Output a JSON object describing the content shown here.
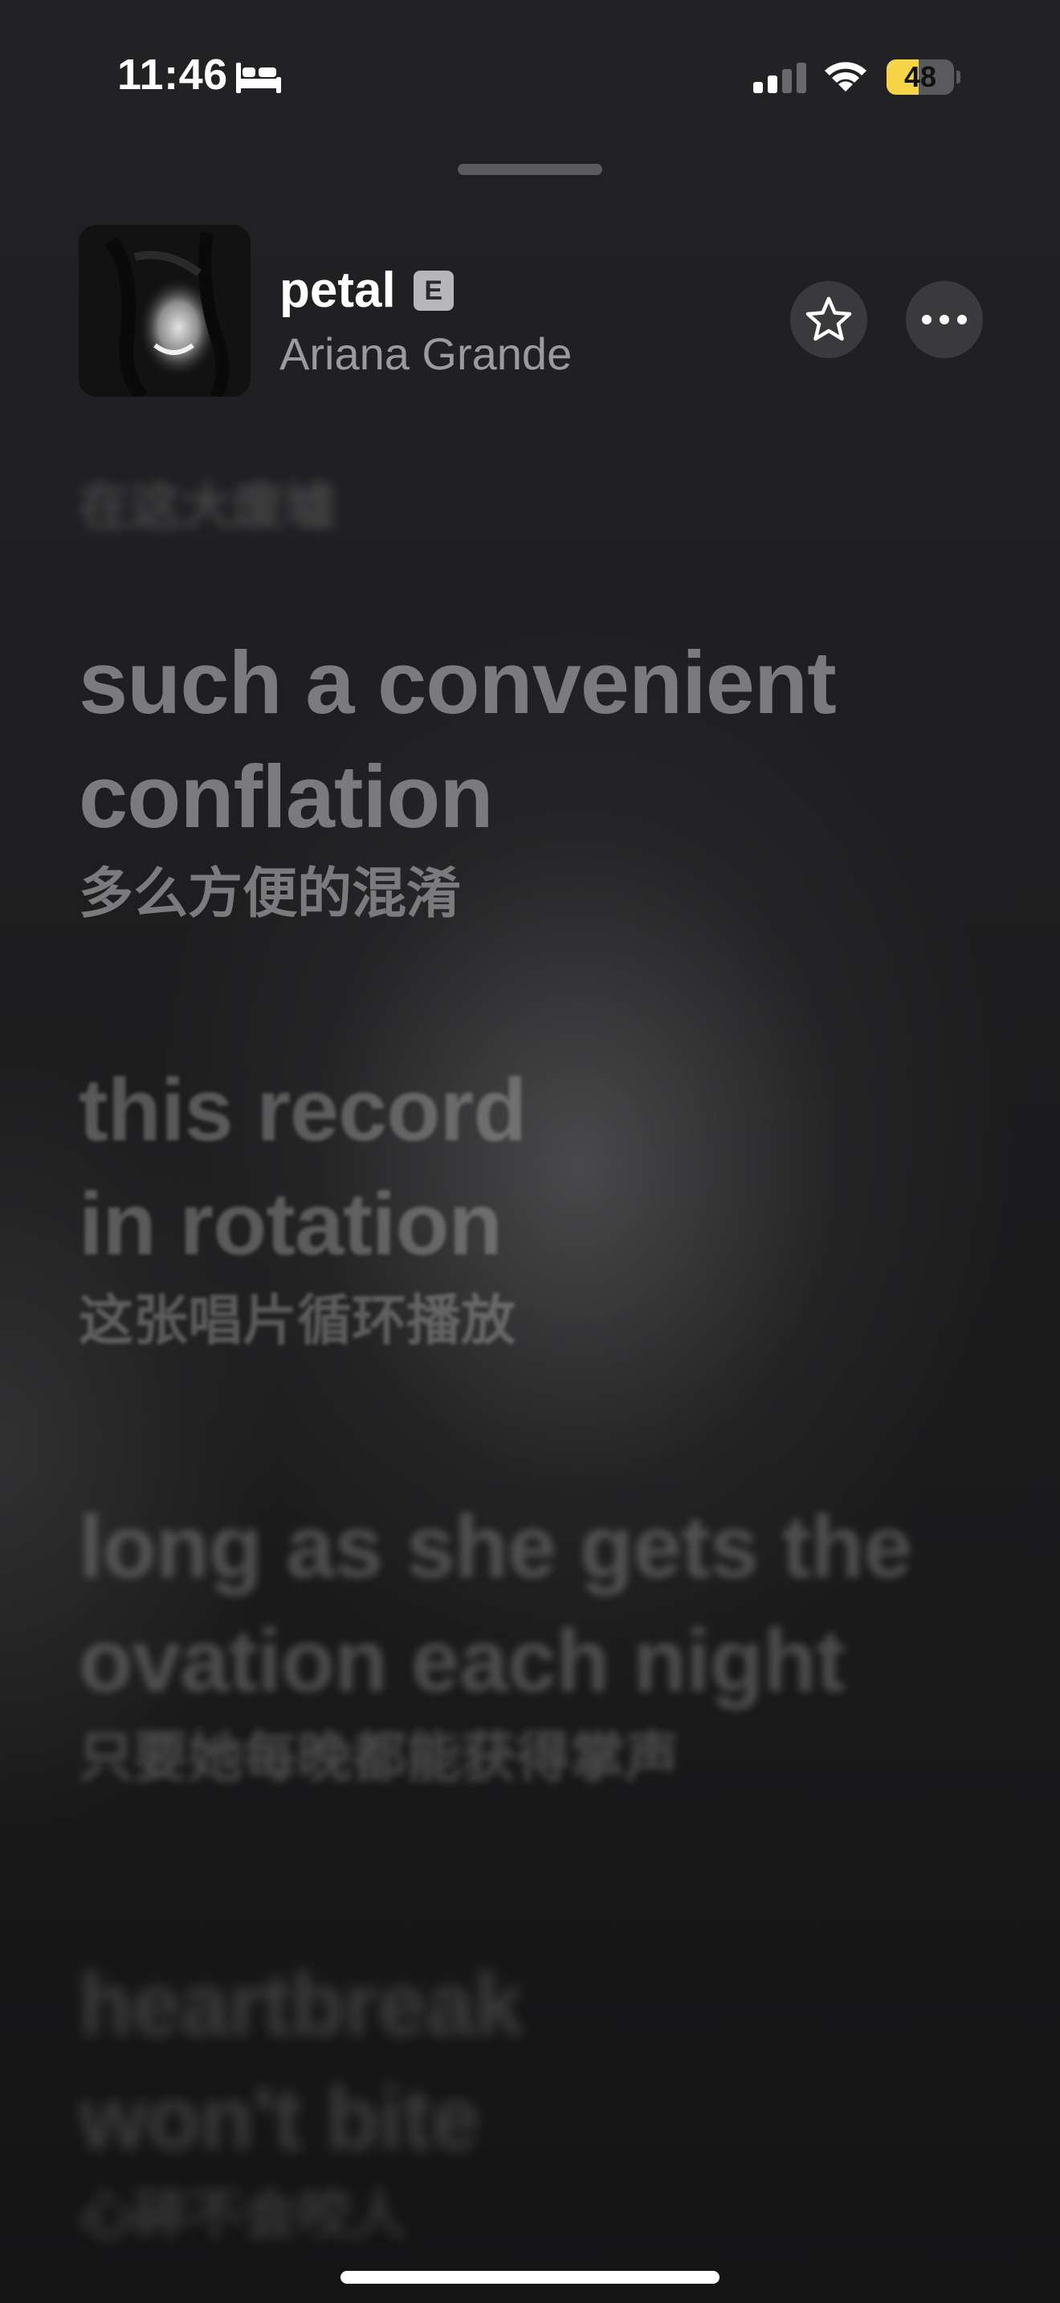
{
  "status_bar": {
    "time": "11:46",
    "battery_level": "48",
    "battery_fraction": 0.48,
    "icons": [
      "bed-icon",
      "cellular-signal-icon",
      "wifi-icon",
      "battery-icon"
    ]
  },
  "now_playing": {
    "title": "petal",
    "explicit_badge": "E",
    "artist": "Ariana Grande",
    "buttons": [
      "star-icon",
      "more-icon"
    ]
  },
  "lyrics": {
    "previous_translation": "在这大废墟",
    "lines": [
      {
        "text_1": "such a convenient",
        "text_2": "conflation",
        "translation": "多么方便的混淆"
      },
      {
        "text_1": "this record",
        "text_2": "in rotation",
        "translation": "这张唱片循环播放"
      },
      {
        "text_1": "long as she gets the",
        "text_2": "ovation each night",
        "translation": "只要她每晚都能获得掌声"
      },
      {
        "text_1": "heartbreak",
        "text_2": "won't bite",
        "translation": "心碎不会咬人"
      }
    ]
  },
  "colors": {
    "background": "#1c1c1e",
    "current_lyric": "#7b7b7d",
    "artist_text": "#9b9b9e",
    "battery_fill": "#f5d547"
  }
}
